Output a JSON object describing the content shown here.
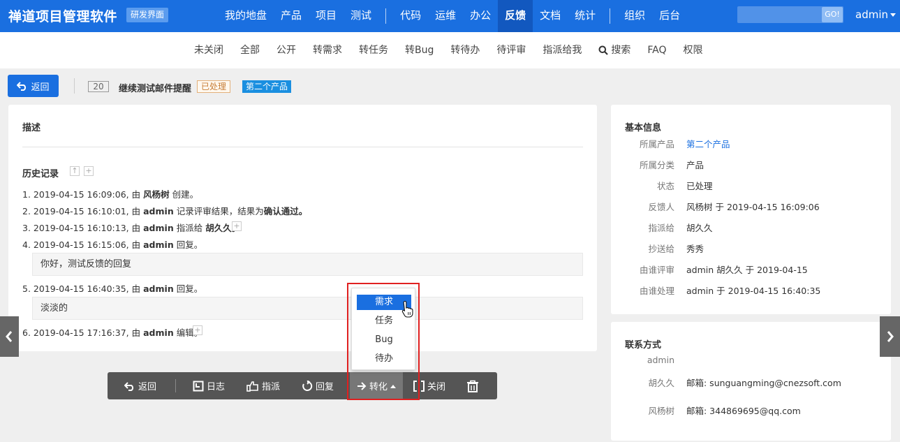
{
  "app": {
    "title": "禅道项目管理软件",
    "badge": "研发界面"
  },
  "main_nav": {
    "group1": [
      "我的地盘",
      "产品",
      "项目",
      "测试"
    ],
    "group2": [
      "代码",
      "运维",
      "办公",
      "反馈",
      "文档",
      "统计"
    ],
    "group3": [
      "组织",
      "后台"
    ],
    "active": "反馈"
  },
  "top_search": {
    "value": "",
    "button": "GO!"
  },
  "user": "admin",
  "sub_nav": {
    "items": [
      "未关闭",
      "全部",
      "公开",
      "转需求",
      "转任务",
      "转Bug",
      "转待办",
      "待评审",
      "指派给我",
      "搜索",
      "FAQ",
      "权限"
    ]
  },
  "header": {
    "back_label": "返回",
    "id": "20",
    "title": "继续测试邮件提醒",
    "status": "已处理",
    "product": "第二个产品"
  },
  "main": {
    "desc_title": "描述",
    "history_title": "历史记录",
    "history": [
      {
        "num": "1.",
        "time": "2019-04-15 16:09:06, 由",
        "actor": "风杨树",
        "action": "创建。"
      },
      {
        "num": "2.",
        "time": "2019-04-15 16:10:01, 由",
        "actor": "admin",
        "action": "记录评审结果，结果为",
        "extra": "确认通过。"
      },
      {
        "num": "3.",
        "time": "2019-04-15 16:10:13, 由",
        "actor": "admin",
        "action": "指派给",
        "extra": "胡久久。"
      },
      {
        "num": "4.",
        "time": "2019-04-15 16:15:06, 由",
        "actor": "admin",
        "action": "回复。",
        "comment": "你好，测试反馈的回复"
      },
      {
        "num": "5.",
        "time": "2019-04-15 16:40:35, 由",
        "actor": "admin",
        "action": "回复。",
        "comment": "淡淡的"
      },
      {
        "num": "6.",
        "time": "2019-04-15 17:16:37, 由",
        "actor": "admin",
        "action": "编辑。"
      }
    ]
  },
  "basic_info": {
    "title": "基本信息",
    "rows": [
      {
        "label": "所属产品",
        "value": "第二个产品"
      },
      {
        "label": "所属分类",
        "value": "产品"
      },
      {
        "label": "状态",
        "value": "已处理"
      },
      {
        "label": "反馈人",
        "value": "风杨树 于 2019-04-15 16:09:06"
      },
      {
        "label": "指派给",
        "value": "胡久久"
      },
      {
        "label": "抄送给",
        "value": "秀秀"
      },
      {
        "label": "由谁评审",
        "value": "admin 胡久久 于 2019-04-15"
      },
      {
        "label": "由谁处理",
        "value": "admin 于 2019-04-15 16:40:35"
      }
    ]
  },
  "contacts": {
    "title": "联系方式",
    "rows": [
      {
        "label": "admin",
        "value": ""
      },
      {
        "label": "胡久久",
        "value": "邮箱: sunguangming@cnezsoft.com"
      },
      {
        "label": "风杨树",
        "value": "邮箱: 344869695@qq.com"
      }
    ]
  },
  "actions": {
    "back": "返回",
    "log": "日志",
    "assign": "指派",
    "reply": "回复",
    "convert": "转化",
    "close": "关闭"
  },
  "convert_menu": {
    "items": [
      "需求",
      "任务",
      "Bug",
      "待办"
    ],
    "highlighted": "需求"
  },
  "colors": {
    "primary": "#1a6fe0",
    "highlight_box": "#e02020"
  }
}
